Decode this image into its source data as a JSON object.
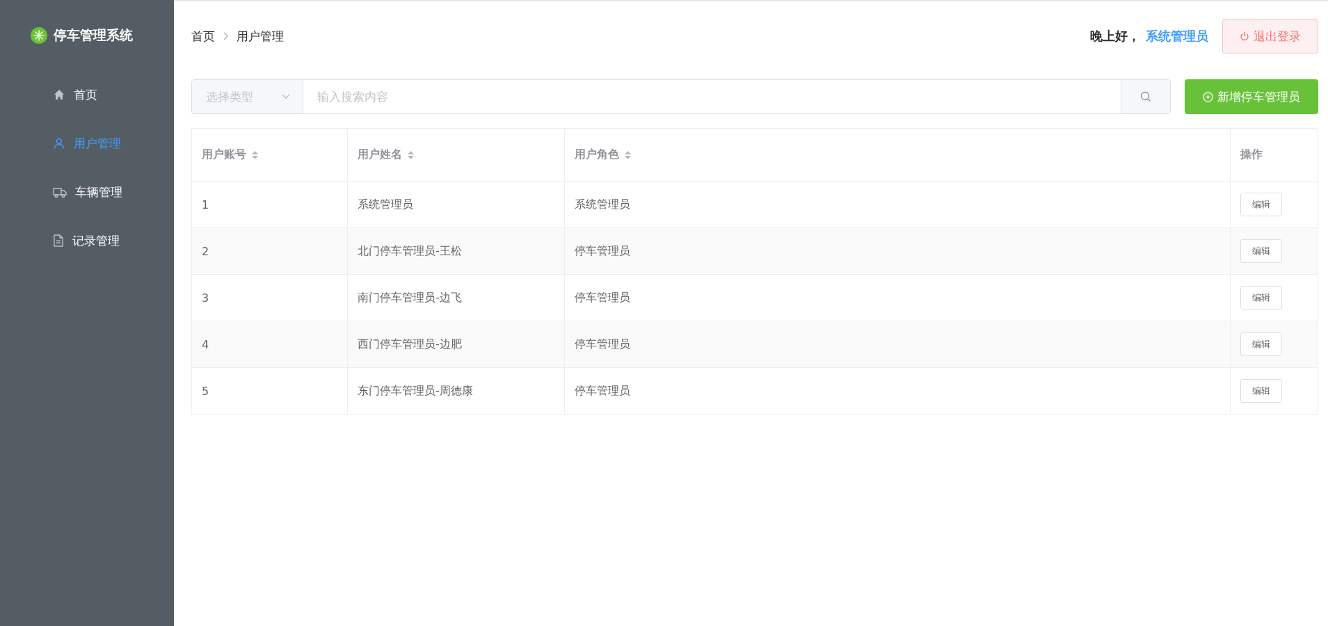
{
  "sidebar": {
    "title": "停车管理系统",
    "items": [
      {
        "label": "首页",
        "selected": false
      },
      {
        "label": "用户管理",
        "selected": true
      },
      {
        "label": "车辆管理",
        "selected": false
      },
      {
        "label": "记录管理",
        "selected": false
      }
    ]
  },
  "header": {
    "breadcrumb": [
      "首页",
      "用户管理"
    ],
    "greeting": "晚上好，",
    "username": "系统管理员",
    "logout_button": "退出登录"
  },
  "toolbar": {
    "type_select": {
      "placeholder": "选择类型"
    },
    "search": {
      "placeholder": "输入搜索内容"
    },
    "add_button": "新增停车管理员"
  },
  "table": {
    "columns": [
      {
        "label": "用户账号",
        "sortable": true
      },
      {
        "label": "用户姓名",
        "sortable": true
      },
      {
        "label": "用户角色",
        "sortable": true
      },
      {
        "label": "操作",
        "sortable": false
      }
    ],
    "rows": [
      {
        "account": "1",
        "name": "系统管理员",
        "role": "系统管理员",
        "action": "编辑"
      },
      {
        "account": "2",
        "name": "北门停车管理员-王松",
        "role": "停车管理员",
        "action": "编辑"
      },
      {
        "account": "3",
        "name": "南门停车管理员-边飞",
        "role": "停车管理员",
        "action": "编辑"
      },
      {
        "account": "4",
        "name": "西门停车管理员-边肥",
        "role": "停车管理员",
        "action": "编辑"
      },
      {
        "account": "5",
        "name": "东门停车管理员-周德康",
        "role": "停车管理员",
        "action": "编辑"
      }
    ]
  }
}
